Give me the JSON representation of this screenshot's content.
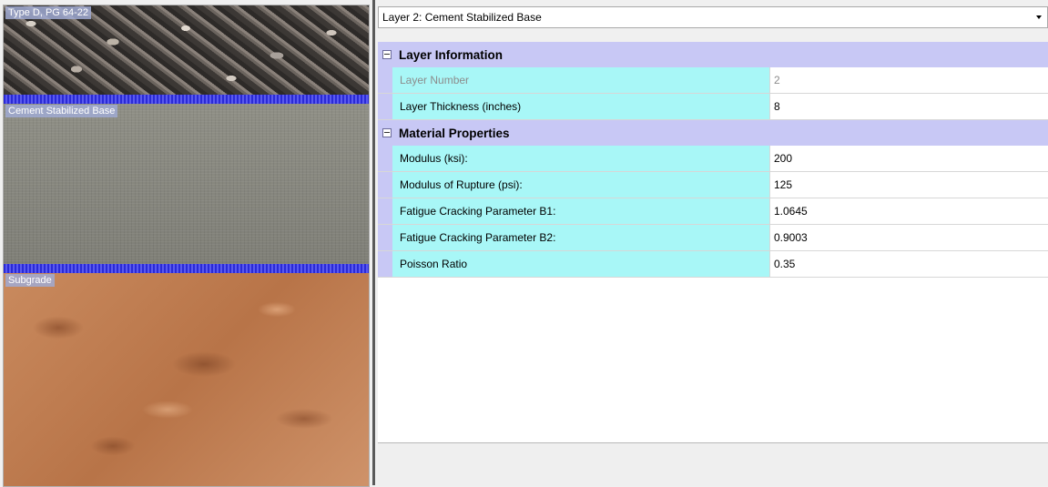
{
  "stack": {
    "layers": [
      {
        "label": "Type D, PG 64-22"
      },
      {
        "label": "Cement Stabilized Base"
      },
      {
        "label": "Subgrade"
      }
    ]
  },
  "selector": {
    "value": "Layer 2: Cement Stabilized Base"
  },
  "grid": {
    "categories": [
      {
        "name": "Layer Information",
        "rows": [
          {
            "name": "Layer Number",
            "value": "2"
          },
          {
            "name": "Layer Thickness (inches)",
            "value": "8"
          }
        ]
      },
      {
        "name": "Material Properties",
        "rows": [
          {
            "name": "Modulus (ksi):",
            "value": "200"
          },
          {
            "name": "Modulus of Rupture (psi):",
            "value": "125"
          },
          {
            "name": "Fatigue Cracking Parameter B1:",
            "value": "1.0645"
          },
          {
            "name": "Fatigue Cracking Parameter B2:",
            "value": "0.9003"
          },
          {
            "name": "Poisson Ratio",
            "value": "0.35"
          }
        ]
      }
    ]
  },
  "colors": {
    "category_bg": "#c8c8f5",
    "name_cell_bg": "#a8f7f7",
    "separator_blue": "#2a2ad6"
  }
}
